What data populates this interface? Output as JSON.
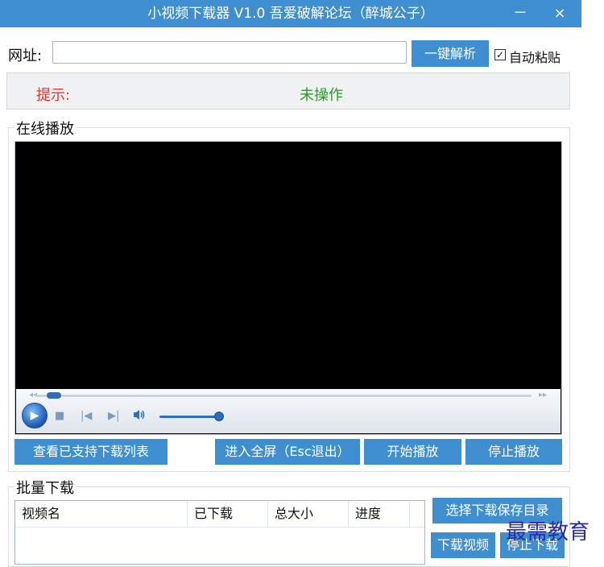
{
  "window": {
    "title": "小视频下载器 V1.0   吾爱破解论坛（醉城公子）",
    "minimize_glyph": "－",
    "close_glyph": "×",
    "accent_color": "#3f8fd0"
  },
  "url_row": {
    "label": "网址:",
    "input_value": "",
    "parse_button": "一键解析",
    "auto_paste_label": "自动粘贴",
    "auto_paste_checked": true,
    "check_glyph": "✓"
  },
  "hint": {
    "label": "提示:",
    "status": "未操作",
    "label_color": "#e53333",
    "status_color": "#2d9a2d"
  },
  "online_play": {
    "title": "在线播放",
    "player": {
      "seek_position": 0.03,
      "volume_level": 1.0,
      "icons": [
        "rewind-icon",
        "fast-forward-icon",
        "play-icon",
        "stop-icon",
        "previous-icon",
        "next-icon",
        "volume-icon"
      ],
      "glyphs": {
        "rewind": "◂◂",
        "ff": "▸▸",
        "play": "▶",
        "stop": "■",
        "prev": "|◀",
        "next": "▶|",
        "volume": "🔊"
      }
    },
    "buttons": {
      "supported_list": "查看已支持下载列表",
      "fullscreen": "进入全屏（Esc退出）",
      "start": "开始播放",
      "stop": "停止播放"
    }
  },
  "batch_download": {
    "title": "批量下载",
    "columns": [
      "视频名",
      "已下载",
      "总大小",
      "进度"
    ],
    "rows": [],
    "buttons": {
      "choose_dir": "选择下载保存目录",
      "download": "下载视频",
      "stop": "停止下载"
    }
  },
  "watermark": "最需教育"
}
